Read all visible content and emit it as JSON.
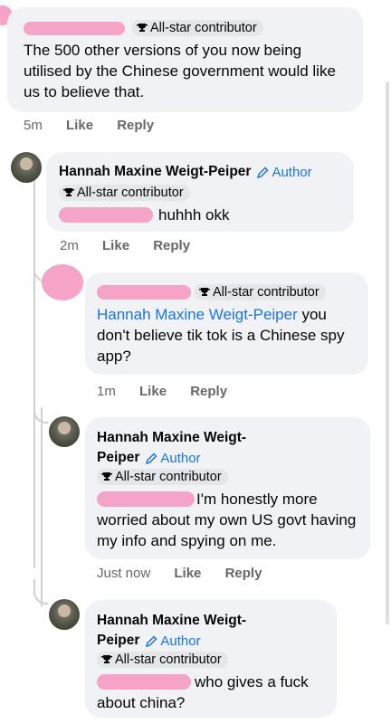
{
  "badge_label": "All-star contributor",
  "author_label": "Author",
  "like_label": "Like",
  "reply_label": "Reply",
  "comments": [
    {
      "text": "The 500 other versions of you now being utilised by the Chinese government would like us to believe that.",
      "time": "5m"
    },
    {
      "name": "Hannah Maxine Weigt-Peiper",
      "text": "huhhh okk",
      "time": "2m"
    },
    {
      "mention": "Hannah Maxine Weigt-Peiper",
      "text": " you don't believe tik tok is a Chinese spy app?",
      "time": "1m"
    },
    {
      "name_line1": "Hannah Maxine Weigt-",
      "name_line2": "Peiper",
      "text_line1": "I'm honestly more",
      "text_rest": "worried about my own US govt having my info and spying on me.",
      "time": "Just now"
    },
    {
      "name_line1": "Hannah Maxine Weigt-",
      "name_line2": "Peiper",
      "text_line1": "who gives a fuck",
      "text_rest": "about china?"
    }
  ],
  "colors": {
    "link": "#1b74e4",
    "bubble": "#f0f2f5",
    "redaction": "#f5a3c7",
    "meta": "#65676b"
  },
  "icons": [
    "trophy-icon",
    "pencil-icon"
  ]
}
